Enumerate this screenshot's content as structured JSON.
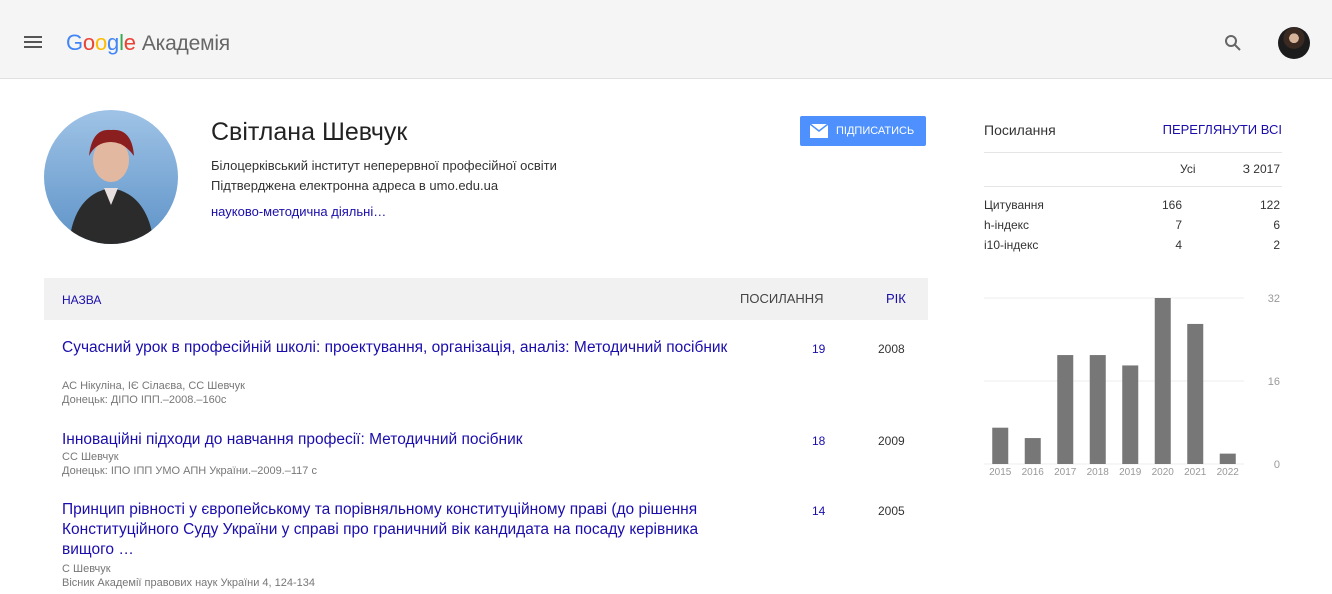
{
  "header": {
    "logo_brand": "Google",
    "logo_product": "Академія",
    "search_icon": "search-icon",
    "menu_icon": "hamburger-menu-icon"
  },
  "profile": {
    "name": "Світлана Шевчук",
    "affiliation": "Білоцерківський інститут неперервної професійної освіти",
    "email_verified": "Підтверджена електронна адреса в umo.edu.ua",
    "interests": "науково-методична діяльні…",
    "follow_label": "ПІДПИСАТИСЬ"
  },
  "table": {
    "col_title": "НАЗВА",
    "col_cited": "ПОСИЛАННЯ",
    "col_year": "РІК",
    "rows": [
      {
        "title": "Сучасний урок в професійній школі: проектування, організація, аналіз: Методичний посібник",
        "authors": "АС Нікуліна, ІЄ Сілаєва, СС Шевчук",
        "source": "Донецьк: ДІПО ІПП.–2008.–160с",
        "cited": "19",
        "year": "2008"
      },
      {
        "title": "Інноваційні підходи до навчання професії: Методичний посібник",
        "authors": "СС Шевчук",
        "source": "Донецьк: ІПО ІПП УМО АПН України.–2009.–117 с",
        "cited": "18",
        "year": "2009"
      },
      {
        "title": "Принцип рівності у європейському та порівняльному конституційному праві (до рішення Конституційного Суду України у справі про граничний вік кандидата на посаду керівника вищого …",
        "authors": "С Шевчук",
        "source": "Вісник Академії правових наук України 4, 124-134",
        "cited": "14",
        "year": "2005"
      }
    ]
  },
  "metrics": {
    "title": "Посилання",
    "view_all": "ПЕРЕГЛЯНУТИ ВСІ",
    "col_all": "Усі",
    "col_since": "З 2017",
    "rows": [
      {
        "label": "Цитування",
        "all": "166",
        "since": "122"
      },
      {
        "label": "h-індекс",
        "all": "7",
        "since": "6"
      },
      {
        "label": "i10-індекс",
        "all": "4",
        "since": "2"
      }
    ]
  },
  "chart_data": {
    "type": "bar",
    "categories": [
      "2015",
      "2016",
      "2017",
      "2018",
      "2019",
      "2020",
      "2021",
      "2022"
    ],
    "values": [
      7,
      5,
      21,
      21,
      19,
      32,
      27,
      2
    ],
    "ylim": [
      0,
      32
    ],
    "yticks": [
      "32",
      "16",
      "0"
    ],
    "bar_color": "#777777"
  }
}
